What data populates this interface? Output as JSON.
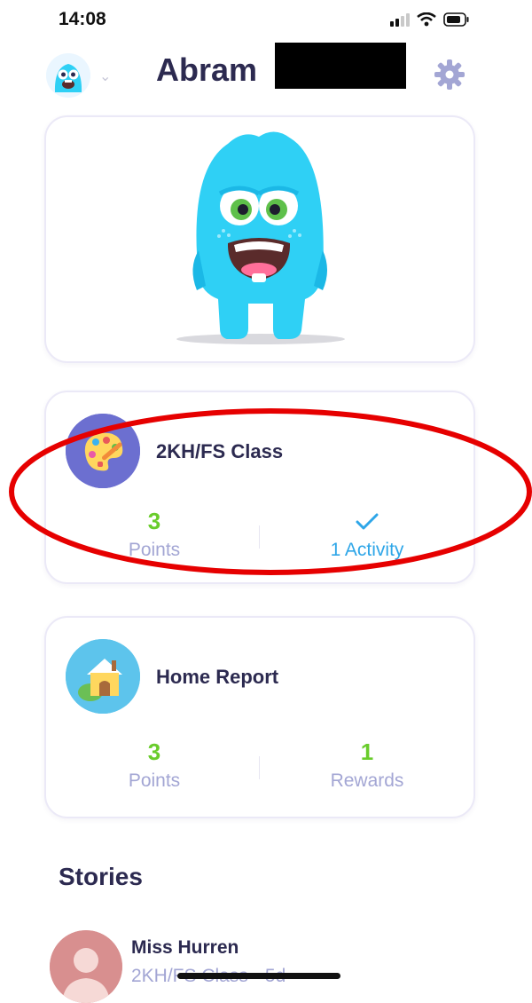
{
  "status_bar": {
    "time": "14:08"
  },
  "header": {
    "user_name": "Abram"
  },
  "class_card": {
    "title": "2KH/FS Class",
    "points_value": "3",
    "points_label": "Points",
    "activity_label": "1 Activity"
  },
  "home_card": {
    "title": "Home Report",
    "points_value": "3",
    "points_label": "Points",
    "rewards_value": "1",
    "rewards_label": "Rewards"
  },
  "stories": {
    "title": "Stories",
    "items": [
      {
        "author": "Miss Hurren",
        "subtitle": "2KH/FS Class • 5d"
      }
    ]
  },
  "colors": {
    "accent_green": "#69cc2b",
    "accent_blue": "#2ea6e8",
    "muted_label": "#a3a6d4",
    "heading": "#2c2a50",
    "annotation_red": "#e60000"
  }
}
